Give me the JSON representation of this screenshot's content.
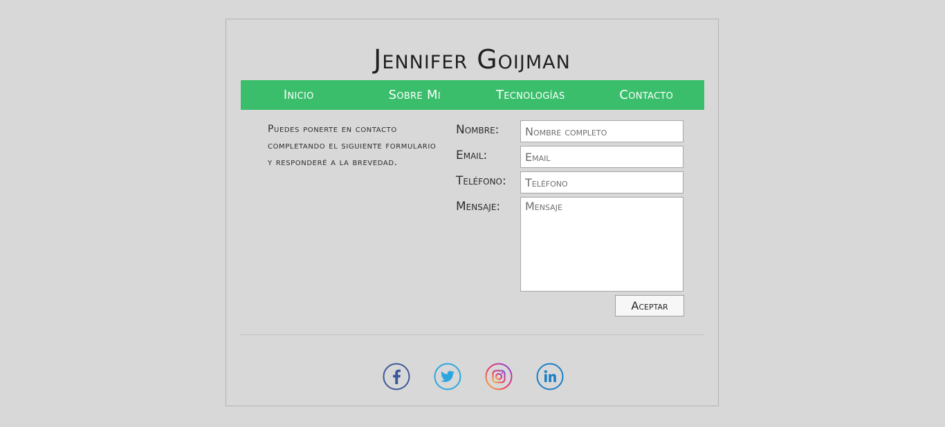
{
  "header": {
    "title": "Jennifer Goijman"
  },
  "nav": {
    "items": [
      {
        "label": "Inicio"
      },
      {
        "label": "Sobre Mi"
      },
      {
        "label": "Tecnologías"
      },
      {
        "label": "Contacto"
      }
    ],
    "color": "#3bbe6c"
  },
  "contact": {
    "intro": "Puedes ponerte en contacto completando el siguiente formulario y responderé a la brevedad.",
    "fields": {
      "name": {
        "label": "Nombre:",
        "placeholder": "Nombre completo",
        "value": ""
      },
      "email": {
        "label": "Email:",
        "placeholder": "Email",
        "value": ""
      },
      "phone": {
        "label": "Teléfono:",
        "placeholder": "Teléfono",
        "value": ""
      },
      "message": {
        "label": "Mensaje:",
        "placeholder": "Mensaje",
        "value": ""
      }
    },
    "submit_label": "Aceptar"
  },
  "social": {
    "icons": [
      "facebook-icon",
      "twitter-icon",
      "instagram-icon",
      "linkedin-icon"
    ]
  }
}
